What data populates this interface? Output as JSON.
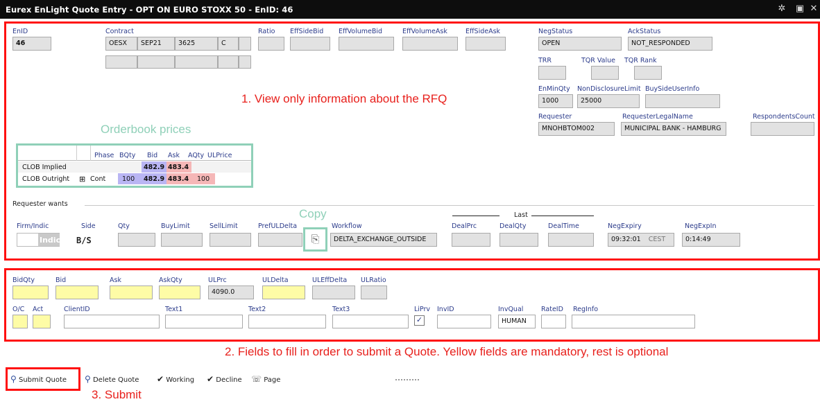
{
  "window": {
    "title": "Eurex EnLight Quote Entry - OPT ON EURO STOXX 50 - EnID: 46",
    "icons": [
      "gear-icon",
      "window-icon",
      "close-icon"
    ]
  },
  "rfq": {
    "enid_label": "EnID",
    "enid_value": "46",
    "contract_label": "Contract",
    "contract_product": "OESX",
    "contract_expiry": "SEP21",
    "contract_strike": "3625",
    "contract_type": "C",
    "ratio_label": "Ratio",
    "effsidebid_label": "EffSideBid",
    "effvolumebid_label": "EffVolumeBid",
    "effvolumeask_label": "EffVolumeAsk",
    "effsideask_label": "EffSideAsk",
    "negstatus_label": "NegStatus",
    "negstatus_value": "OPEN",
    "ackstatus_label": "AckStatus",
    "ackstatus_value": "NOT_RESPONDED",
    "trr_label": "TRR",
    "tqrvalue_label": "TQR Value",
    "tqrrank_label": "TQR Rank",
    "enminqty_label": "EnMinQty",
    "enminqty_value": "1000",
    "nondisclosure_label": "NonDisclosureLimit",
    "nondisclosure_value": "25000",
    "buysideuser_label": "BuySideUserInfo",
    "requester_label": "Requester",
    "requester_value": "MNOHBTOM002",
    "requesterlegal_label": "RequesterLegalName",
    "requesterlegal_value": "MUNICIPAL BANK - HAMBURG",
    "respondents_label": "RespondentsCount"
  },
  "orderbook": {
    "headers": [
      "Phase",
      "BQty",
      "Bid",
      "Ask",
      "AQty",
      "ULPrice"
    ],
    "rows": [
      {
        "name": "CLOB Implied",
        "phase": "",
        "bqty": "",
        "bid": "482.9",
        "ask": "483.4",
        "aqty": ""
      },
      {
        "name": "CLOB Outright",
        "expand": "⊞",
        "phase": "Cont",
        "bqty": "100",
        "bid": "482.9",
        "ask": "483.4",
        "aqty": "100"
      }
    ]
  },
  "requester_wants": {
    "section_label": "Requester wants",
    "last_label": "Last",
    "firm_label": "Firm/Indic",
    "firm_value": "Indic",
    "side_label": "Side",
    "side_value": "B/S",
    "qty_label": "Qty",
    "buylimit_label": "BuyLimit",
    "selllimit_label": "SellLimit",
    "prefuldelta_label": "PrefULDelta",
    "workflow_label": "Workflow",
    "workflow_value": "DELTA_EXCHANGE_OUTSIDE",
    "dealprc_label": "DealPrc",
    "dealqty_label": "DealQty",
    "dealtime_label": "DealTime",
    "negexpiry_label": "NegExpiry",
    "negexpiry_value": "09:32:01",
    "negexpiry_tz": "CEST",
    "negexpin_label": "NegExpIn",
    "negexpin_value": "0:14:49"
  },
  "quote": {
    "bidqty_label": "BidQty",
    "bid_label": "Bid",
    "ask_label": "Ask",
    "askqty_label": "AskQty",
    "ulprc_label": "ULPrc",
    "ulprc_value": "4090.0",
    "uldelta_label": "ULDelta",
    "uleffdelta_label": "ULEffDelta",
    "ulratio_label": "ULRatio",
    "oc_label": "O/C",
    "act_label": "Act",
    "clientid_label": "ClientID",
    "text1_label": "Text1",
    "text2_label": "Text2",
    "text3_label": "Text3",
    "liprv_label": "LiPrv",
    "liprv_checked": "✓",
    "invid_label": "InvID",
    "invqual_label": "InvQual",
    "invqual_value": "HUMAN",
    "rateid_label": "RateID",
    "reginfo_label": "RegInfo"
  },
  "toolbar": {
    "submit": "Submit Quote",
    "delete": "Delete Quote",
    "working": "Working",
    "decline": "Decline",
    "page": "Page"
  },
  "annotations": {
    "a1": "1. View only information about the RFQ",
    "orderbook": "Orderbook prices",
    "copy": "Copy",
    "a2": "2. Fields to fill in order to submit a Quote. Yellow fields are mandatory, rest is optional",
    "a3": "3. Submit"
  },
  "colors": {
    "mandatory": "#fefca6",
    "annotation_red": "#ff1010",
    "annotation_teal": "#8fd0b8",
    "bid": "#b9b5f3",
    "ask": "#f5b7b7"
  }
}
